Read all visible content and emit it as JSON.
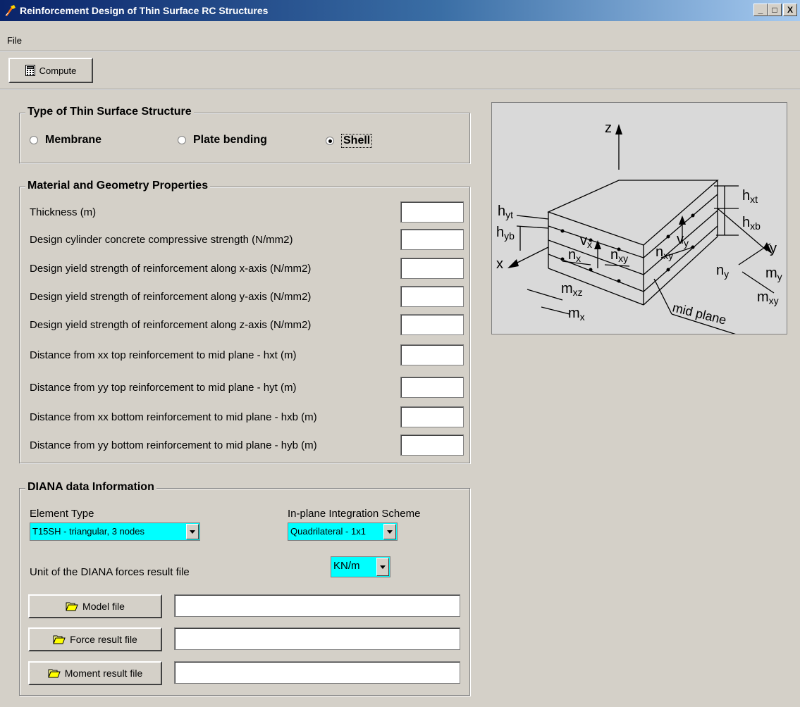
{
  "window": {
    "title": "Reinforcement Design of Thin Surface RC Structures",
    "minimize": "_",
    "maximize": "□",
    "close": "X"
  },
  "menu": {
    "file": "File"
  },
  "toolbar": {
    "compute_label": "Compute"
  },
  "structure_type": {
    "title": "Type of Thin Surface Structure",
    "options": [
      "Membrane",
      "Plate bending",
      "Shell"
    ],
    "selected": "Shell"
  },
  "material": {
    "title": "Material and Geometry Properties",
    "fields": [
      {
        "label": "Thickness (m)",
        "value": ""
      },
      {
        "label": "Design cylinder concrete compressive strength (N/mm2)",
        "value": ""
      },
      {
        "label": "Design yield strength of reinforcement along x-axis (N/mm2)",
        "value": ""
      },
      {
        "label": "Design yield strength of reinforcement along y-axis (N/mm2)",
        "value": ""
      },
      {
        "label": "Design yield strength of reinforcement along z-axis (N/mm2)",
        "value": ""
      },
      {
        "label": "Distance from xx top reinforcement to mid plane - hxt (m)",
        "value": ""
      },
      {
        "label": "Distance from yy top reinforcement to mid plane - hyt (m)",
        "value": ""
      },
      {
        "label": "Distance from xx bottom reinforcement to mid plane - hxb (m)",
        "value": ""
      },
      {
        "label": "Distance from yy bottom reinforcement to mid plane - hyb (m)",
        "value": ""
      }
    ]
  },
  "diana": {
    "title": "DIANA data Information",
    "element_type_label": "Element Type",
    "element_type_value": "T15SH - triangular, 3 nodes",
    "integration_label": "In-plane Integration Scheme",
    "integration_value": "Quadrilateral - 1x1",
    "unit_label": "Unit of the DIANA forces result file",
    "unit_value": "KN/m",
    "model_file_label": "Model file",
    "force_file_label": "Force result file",
    "moment_file_label": "Moment result file",
    "model_file_value": "",
    "force_file_value": "",
    "moment_file_value": ""
  },
  "diagram": {
    "labels": {
      "z": "z",
      "y": "y",
      "x": "x",
      "hxt": "h",
      "hxt_sub": "xt",
      "hxb": "h",
      "hxb_sub": "xb",
      "hyt": "h",
      "hyt_sub": "yt",
      "hyb": "h",
      "hyb_sub": "yb",
      "vx": "v",
      "vx_sub": "x",
      "vy": "v",
      "vy_sub": "y",
      "nx": "n",
      "nx_sub": "x",
      "nxy": "n",
      "nxy_sub": "xy",
      "nxy2": "n",
      "nxy2_sub": "xy",
      "ny": "n",
      "ny_sub": "y",
      "mxz": "m",
      "mxz_sub": "xz",
      "mx": "m",
      "mx_sub": "x",
      "my": "m",
      "my_sub": "y",
      "mxy": "m",
      "mxy_sub": "xy",
      "mid_plane": "mid plane"
    }
  }
}
